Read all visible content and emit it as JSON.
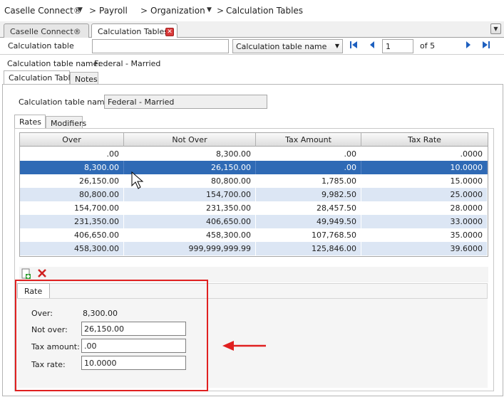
{
  "breadcrumb": [
    "Caselle Connect®",
    "Payroll",
    "Organization",
    "Calculation Tables"
  ],
  "breadcrumb_separator": ">",
  "doc_tabs": [
    {
      "label": "Caselle Connect®",
      "active": false
    },
    {
      "label": "Calculation Tables",
      "active": true
    }
  ],
  "toolbar": {
    "search_label": "Calculation table",
    "search_value": "",
    "sort_by": "Calculation table name",
    "record_current": "1",
    "record_total_label": "of 5"
  },
  "info": {
    "name_label": "Calculation table name:",
    "name_value": "Federal - Married"
  },
  "main_tabs": [
    {
      "label": "Calculation Table",
      "active": true
    },
    {
      "label": "Notes",
      "active": false
    }
  ],
  "form": {
    "name_label": "Calculation table name:",
    "name_value": "Federal - Married"
  },
  "sub_tabs": [
    {
      "label": "Rates",
      "active": true
    },
    {
      "label": "Modifiers",
      "active": false
    }
  ],
  "grid": {
    "columns": [
      "Over",
      "Not Over",
      "Tax Amount",
      "Tax Rate"
    ],
    "rows": [
      [
        ".00",
        "8,300.00",
        ".00",
        ".0000"
      ],
      [
        "8,300.00",
        "26,150.00",
        ".00",
        "10.0000"
      ],
      [
        "26,150.00",
        "80,800.00",
        "1,785.00",
        "15.0000"
      ],
      [
        "80,800.00",
        "154,700.00",
        "9,982.50",
        "25.0000"
      ],
      [
        "154,700.00",
        "231,350.00",
        "28,457.50",
        "28.0000"
      ],
      [
        "231,350.00",
        "406,650.00",
        "49,949.50",
        "33.0000"
      ],
      [
        "406,650.00",
        "458,300.00",
        "107,768.50",
        "35.0000"
      ],
      [
        "458,300.00",
        "999,999,999.99",
        "125,846.00",
        "39.6000"
      ]
    ],
    "selected_row": 1
  },
  "editor": {
    "tab_label": "Rate",
    "over_label": "Over:",
    "over_value": "8,300.00",
    "not_over_label": "Not over:",
    "not_over_value": "26,150.00",
    "tax_amount_label": "Tax amount:",
    "tax_amount_value": ".00",
    "tax_rate_label": "Tax rate:",
    "tax_rate_value": "10.0000"
  },
  "icons": [
    "chevron-down-icon",
    "close-icon",
    "first-record-icon",
    "prev-record-icon",
    "next-record-icon",
    "last-record-icon",
    "add-row-icon",
    "delete-row-icon",
    "mouse-cursor-icon",
    "arrow-annotation-icon"
  ],
  "colors": {
    "selected_row": "#2f6ab5",
    "alt_row": "#dce6f4",
    "annotation": "#e02020",
    "nav_icon": "#1d5fbf"
  }
}
